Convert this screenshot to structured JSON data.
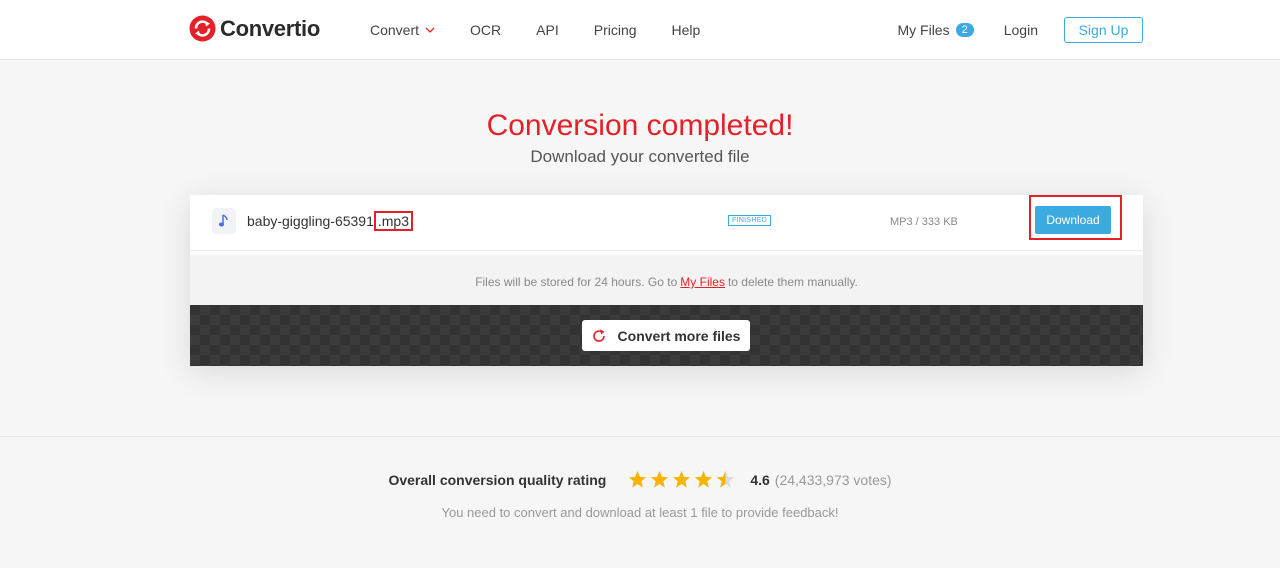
{
  "brand": {
    "name": "Convertio",
    "accent": "#e42128",
    "blue": "#3aaae1"
  },
  "nav": {
    "items": [
      {
        "label": "Convert",
        "has_dropdown": true,
        "icon": "chevron-down-icon"
      },
      {
        "label": "OCR"
      },
      {
        "label": "API"
      },
      {
        "label": "Pricing"
      },
      {
        "label": "Help"
      }
    ],
    "my_files_label": "My Files",
    "my_files_count": "2",
    "login_label": "Login",
    "signup_label": "Sign Up"
  },
  "hero": {
    "title": "Conversion completed!",
    "subtitle": "Download your converted file"
  },
  "file": {
    "icon": "music-note-icon",
    "name": "baby-giggling-65391",
    "extension": ".mp3",
    "status": "FINISHED",
    "format_size": "MP3 / 333 KB",
    "download_label": "Download"
  },
  "note": {
    "prefix": "Files will be stored for 24 hours. Go to",
    "link": "My Files",
    "suffix": "to delete them manually."
  },
  "convert_more": {
    "label": "Convert more files",
    "icon": "refresh-icon"
  },
  "rating": {
    "label": "Overall conversion quality rating",
    "stars": 4.5,
    "score": "4.6",
    "votes": "(24,433,973 votes)",
    "feedback": "You need to convert and download at least 1 file to provide feedback!"
  }
}
